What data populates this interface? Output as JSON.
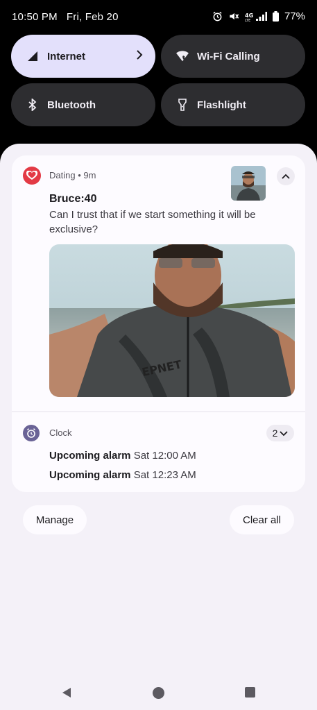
{
  "status_bar": {
    "time": "10:50 PM",
    "date": "Fri, Feb 20",
    "battery_percent": "77%",
    "icons": [
      "alarm-icon",
      "mute-icon",
      "lte-icon",
      "signal-icon",
      "battery-icon"
    ]
  },
  "quick_tiles": [
    {
      "label": "Internet",
      "icon": "cell-signal-icon",
      "active": true,
      "has_chevron": true
    },
    {
      "label": "Wi-Fi Calling",
      "icon": "wifi-calling-icon",
      "active": false
    },
    {
      "label": "Bluetooth",
      "icon": "bluetooth-icon",
      "active": false
    },
    {
      "label": "Flashlight",
      "icon": "flashlight-icon",
      "active": false
    }
  ],
  "notifications": {
    "dating": {
      "app_name": "Dating",
      "separator": "•",
      "time": "9m",
      "title": "Bruce:40",
      "body": "Can I trust that if we start something it will be exclusive?",
      "icon": "heart-icon",
      "accent": "#e33a45"
    },
    "clock": {
      "app_name": "Clock",
      "count": "2",
      "icon": "alarm-clock-icon",
      "accent": "#6a6396",
      "alarms": [
        {
          "label": "Upcoming alarm",
          "time": "Sat 12:00 AM"
        },
        {
          "label": "Upcoming alarm",
          "time": "Sat 12:23 AM"
        }
      ]
    }
  },
  "actions": {
    "manage_label": "Manage",
    "clear_all_label": "Clear all"
  },
  "colors": {
    "active_tile": "#e3e0fb",
    "inactive_tile": "#2d2d30",
    "shade_background": "#f4f1f8"
  }
}
